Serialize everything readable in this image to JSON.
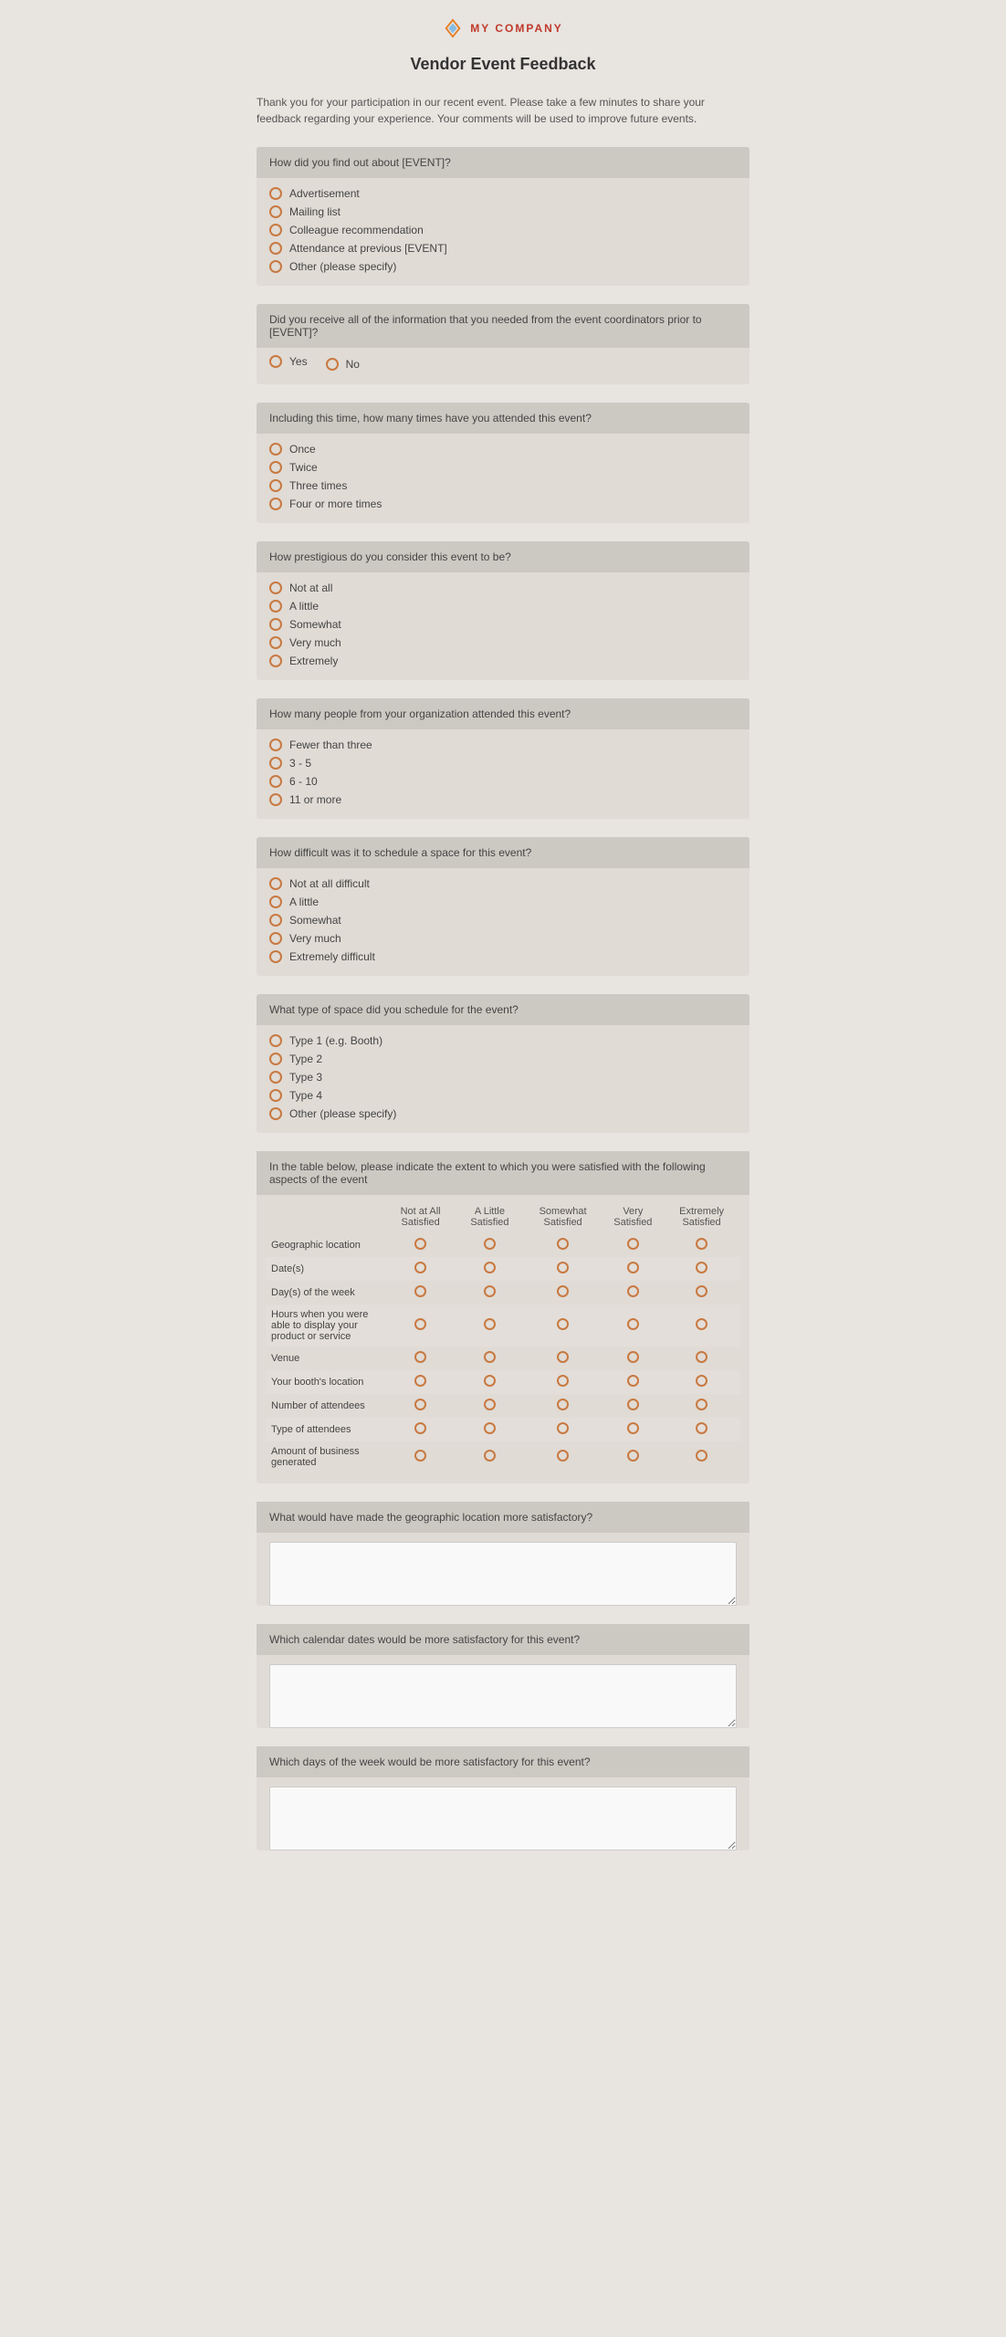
{
  "company": {
    "name": "MY COMPANY"
  },
  "page": {
    "title": "Vendor Event Feedback"
  },
  "intro": {
    "text": "Thank you for your participation in our recent event. Please take a few minutes to share your feedback regarding your experience. Your comments will be used to improve future events."
  },
  "questions": [
    {
      "id": "q1",
      "text": "How did you find out about [EVENT]?",
      "type": "radio",
      "options": [
        "Advertisement",
        "Mailing list",
        "Colleague recommendation",
        "Attendance at previous [EVENT]",
        "Other (please specify)"
      ]
    },
    {
      "id": "q2",
      "text": "Did you receive all of the information that you needed from the event coordinators prior to [EVENT]?",
      "type": "radio-inline",
      "options": [
        "Yes",
        "No"
      ]
    },
    {
      "id": "q3",
      "text": "Including this time, how many times have you attended this event?",
      "type": "radio",
      "options": [
        "Once",
        "Twice",
        "Three times",
        "Four or more times"
      ]
    },
    {
      "id": "q4",
      "text": "How prestigious do you consider this event to be?",
      "type": "radio",
      "options": [
        "Not at all",
        "A little",
        "Somewhat",
        "Very much",
        "Extremely"
      ]
    },
    {
      "id": "q5",
      "text": "How many people from your organization attended this event?",
      "type": "radio",
      "options": [
        "Fewer than three",
        "3 - 5",
        "6 - 10",
        "11 or more"
      ]
    },
    {
      "id": "q6",
      "text": "How difficult was it to schedule a space for this event?",
      "type": "radio",
      "options": [
        "Not at all difficult",
        "A little",
        "Somewhat",
        "Very much",
        "Extremely difficult"
      ]
    },
    {
      "id": "q7",
      "text": "What type of space did you schedule for the event?",
      "type": "radio",
      "options": [
        "Type 1 (e.g. Booth)",
        "Type 2",
        "Type 3",
        "Type 4",
        "Other (please specify)"
      ]
    }
  ],
  "satisfaction": {
    "header": "In the table below, please indicate the extent to which you were satisfied with the following aspects of the event",
    "columns": [
      "Not at All Satisfied",
      "A Little Satisfied",
      "Somewhat Satisfied",
      "Very Satisfied",
      "Extremely Satisfied"
    ],
    "rows": [
      "Geographic location",
      "Date(s)",
      "Day(s) of the week",
      "Hours when you were able to display your product or service",
      "Venue",
      "Your booth's location",
      "Number of attendees",
      "Type of attendees",
      "Amount of business generated"
    ]
  },
  "open_questions": [
    {
      "id": "oq1",
      "text": "What would have made the geographic location more satisfactory?"
    },
    {
      "id": "oq2",
      "text": "Which calendar dates would be more satisfactory for this event?"
    },
    {
      "id": "oq3",
      "text": "Which days of the week would be more satisfactory for this event?"
    }
  ]
}
